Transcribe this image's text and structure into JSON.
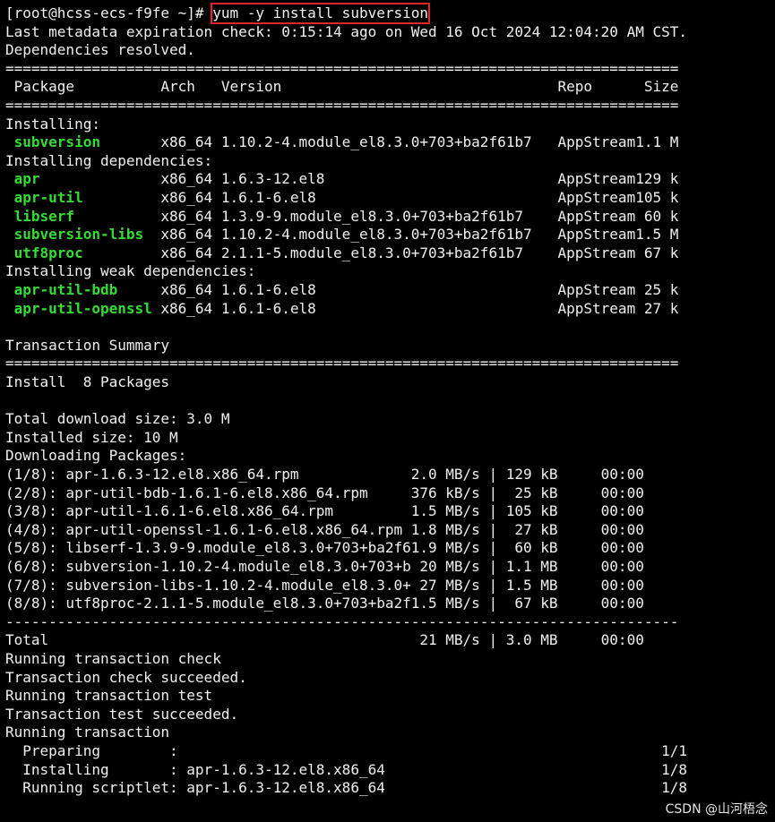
{
  "colors": {
    "background": "#000000",
    "text": "#f0f0f0",
    "package_name": "#33dd33",
    "highlight_box": "#e0262b"
  },
  "prompt": {
    "prefix": "[root@hcss-ecs-f9fe ~]# ",
    "command": "yum -y install subversion"
  },
  "header_lines": [
    "Last metadata expiration check: 0:15:14 ago on Wed 16 Oct 2024 12:04:20 AM CST.",
    "Dependencies resolved."
  ],
  "separator_double": "================================================================================",
  "separator_single": "--------------------------------------------------------------------------------",
  "table_header": {
    "package": "Package",
    "arch": "Arch",
    "version": "Version",
    "repo": "Repo",
    "size": "Size"
  },
  "groups": [
    {
      "label": "Installing:",
      "packages": [
        {
          "name": "subversion",
          "arch": "x86_64",
          "version": "1.10.2-4.module_el8.3.0+703+ba2f61b7",
          "repo": "AppStream",
          "size": "1.1 M"
        }
      ]
    },
    {
      "label": "Installing dependencies:",
      "packages": [
        {
          "name": "apr",
          "arch": "x86_64",
          "version": "1.6.3-12.el8",
          "repo": "AppStream",
          "size": "129 k"
        },
        {
          "name": "apr-util",
          "arch": "x86_64",
          "version": "1.6.1-6.el8",
          "repo": "AppStream",
          "size": "105 k"
        },
        {
          "name": "libserf",
          "arch": "x86_64",
          "version": "1.3.9-9.module_el8.3.0+703+ba2f61b7",
          "repo": "AppStream",
          "size": "60 k"
        },
        {
          "name": "subversion-libs",
          "arch": "x86_64",
          "version": "1.10.2-4.module_el8.3.0+703+ba2f61b7",
          "repo": "AppStream",
          "size": "1.5 M"
        },
        {
          "name": "utf8proc",
          "arch": "x86_64",
          "version": "2.1.1-5.module_el8.3.0+703+ba2f61b7",
          "repo": "AppStream",
          "size": "67 k"
        }
      ]
    },
    {
      "label": "Installing weak dependencies:",
      "packages": [
        {
          "name": "apr-util-bdb",
          "arch": "x86_64",
          "version": "1.6.1-6.el8",
          "repo": "AppStream",
          "size": "25 k"
        },
        {
          "name": "apr-util-openssl",
          "arch": "x86_64",
          "version": "1.6.1-6.el8",
          "repo": "AppStream",
          "size": "27 k"
        }
      ]
    }
  ],
  "transaction_summary": {
    "title": "Transaction Summary",
    "install_line": "Install  8 Packages"
  },
  "sizes": {
    "download": "Total download size: 3.0 M",
    "installed": "Installed size: 10 M"
  },
  "downloading_label": "Downloading Packages:",
  "downloads": [
    {
      "idx": "(1/8):",
      "file": "apr-1.6.3-12.el8.x86_64.rpm",
      "rate": "2.0 MB/s",
      "size": "129 kB",
      "time": "00:00"
    },
    {
      "idx": "(2/8):",
      "file": "apr-util-bdb-1.6.1-6.el8.x86_64.rpm",
      "rate": "376 kB/s",
      "size": "25 kB",
      "time": "00:00"
    },
    {
      "idx": "(3/8):",
      "file": "apr-util-1.6.1-6.el8.x86_64.rpm",
      "rate": "1.5 MB/s",
      "size": "105 kB",
      "time": "00:00"
    },
    {
      "idx": "(4/8):",
      "file": "apr-util-openssl-1.6.1-6.el8.x86_64.rpm",
      "rate": "1.8 MB/s",
      "size": "27 kB",
      "time": "00:00"
    },
    {
      "idx": "(5/8):",
      "file": "libserf-1.3.9-9.module_el8.3.0+703+ba2f6",
      "rate": "1.9 MB/s",
      "size": "60 kB",
      "time": "00:00"
    },
    {
      "idx": "(6/8):",
      "file": "subversion-1.10.2-4.module_el8.3.0+703+b",
      "rate": "20 MB/s",
      "size": "1.1 MB",
      "time": "00:00"
    },
    {
      "idx": "(7/8):",
      "file": "subversion-libs-1.10.2-4.module_el8.3.0+",
      "rate": "27 MB/s",
      "size": "1.5 MB",
      "time": "00:00"
    },
    {
      "idx": "(8/8):",
      "file": "utf8proc-2.1.1-5.module_el8.3.0+703+ba2f",
      "rate": "1.5 MB/s",
      "size": "67 kB",
      "time": "00:00"
    }
  ],
  "total": {
    "label": "Total",
    "rate": "21 MB/s",
    "size": "3.0 MB",
    "time": "00:00"
  },
  "status_lines": [
    "Running transaction check",
    "Transaction check succeeded.",
    "Running transaction test",
    "Transaction test succeeded.",
    "Running transaction"
  ],
  "progress": [
    {
      "label": "Preparing",
      "pkg": "",
      "count": "1/1"
    },
    {
      "label": "Installing",
      "pkg": "apr-1.6.3-12.el8.x86_64",
      "count": "1/8"
    },
    {
      "label": "Running scriptlet",
      "pkg": "apr-1.6.3-12.el8.x86_64",
      "count": "1/8"
    }
  ],
  "watermark": "CSDN @山河梧念"
}
